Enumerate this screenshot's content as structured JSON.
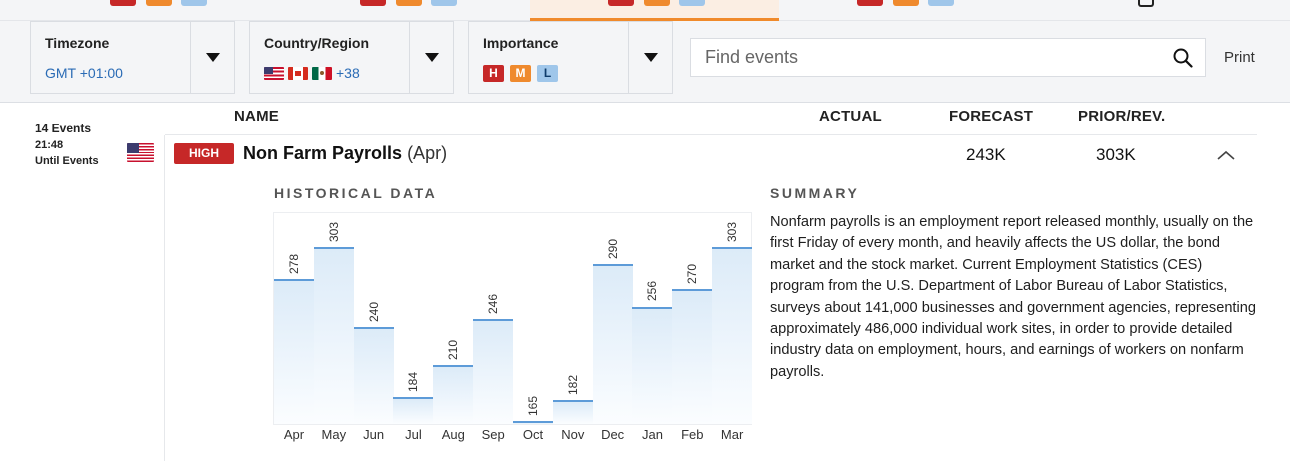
{
  "filters": {
    "timezone": {
      "label": "Timezone",
      "value": "GMT +01:00"
    },
    "country": {
      "label": "Country/Region",
      "flags": [
        "us-flag",
        "canada-flag",
        "mexico-flag"
      ],
      "more": "+38"
    },
    "importance": {
      "label": "Importance",
      "levels": [
        "H",
        "M",
        "L"
      ]
    }
  },
  "search": {
    "placeholder": "Find events"
  },
  "print_label": "Print",
  "columns": {
    "name": "NAME",
    "actual": "ACTUAL",
    "forecast": "FORECAST",
    "prior": "PRIOR/REV."
  },
  "left": {
    "events_count": "14 Events",
    "time": "21:48",
    "until": "Until Events"
  },
  "event": {
    "country_icon": "us-flag",
    "importance": "HIGH",
    "name": "Non Farm Payrolls",
    "period": "(Apr)",
    "actual": "",
    "forecast": "243K",
    "prior": "303K"
  },
  "historical_title": "HISTORICAL DATA",
  "summary_title": "SUMMARY",
  "summary_text": "Nonfarm payrolls is an employment report released monthly, usually on the first Friday of every month, and heavily affects the US dollar, the bond market and the stock market. Current Employment Statistics (CES) program from the U.S. Department of Labor Bureau of Labor Statistics, surveys about 141,000 businesses and government agencies, representing approximately 486,000 individual work sites, in order to provide detailed industry data on employment, hours, and earnings of workers on nonfarm payrolls.",
  "colors": {
    "high": "#c62828",
    "medium": "#ef8a2e",
    "low": "#9fc6ea",
    "link": "#2a6bb5",
    "bar_line": "#5d9bd8",
    "active_tab": "#f08a2b"
  },
  "chart_data": {
    "type": "bar",
    "categories": [
      "Apr",
      "May",
      "Jun",
      "Jul",
      "Aug",
      "Sep",
      "Oct",
      "Nov",
      "Dec",
      "Jan",
      "Feb",
      "Mar"
    ],
    "values": [
      278,
      303,
      240,
      184,
      210,
      246,
      165,
      182,
      290,
      256,
      270,
      303
    ],
    "ylim": [
      163,
      330
    ],
    "grid": false,
    "legend": "none"
  }
}
